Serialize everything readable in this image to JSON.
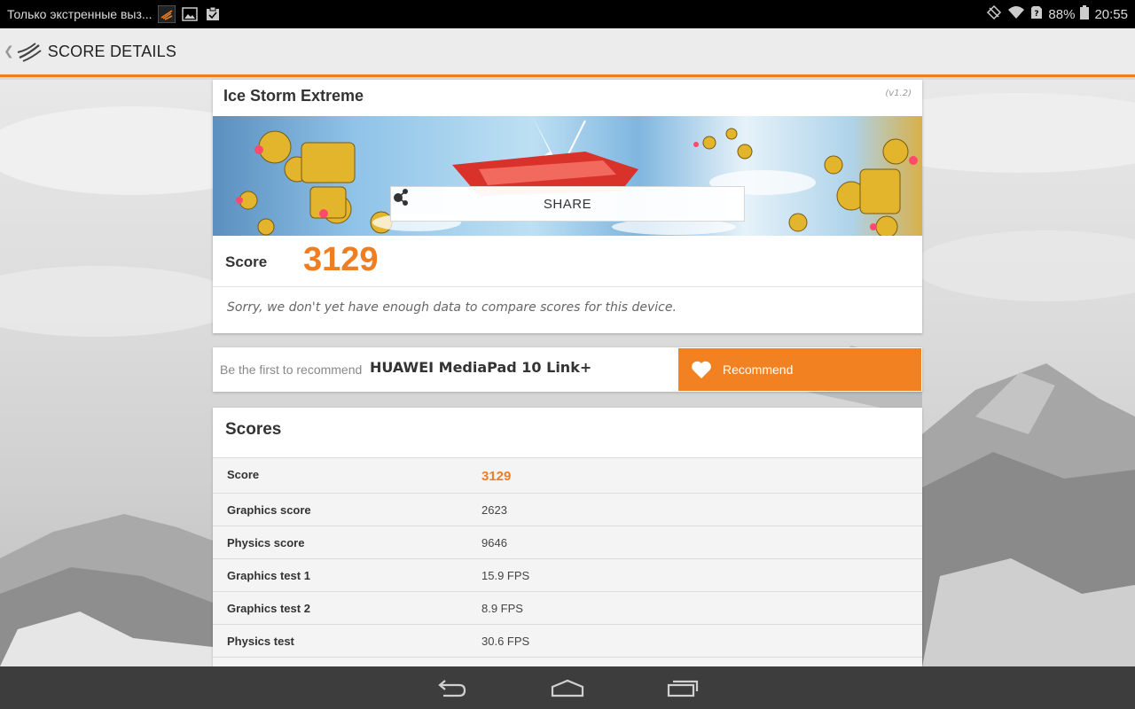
{
  "status_bar": {
    "notification_text": "Только экстренные выз...",
    "battery": "88%",
    "time": "20:55"
  },
  "action_bar": {
    "title": "SCORE DETAILS"
  },
  "test_card": {
    "title": "Ice Storm Extreme",
    "version": "(v1.2)",
    "share_label": "SHARE",
    "score_label": "Score",
    "score_value": "3129",
    "compare_note": "Sorry, we don't yet have enough data to compare scores for this device."
  },
  "recommend": {
    "prefix": "Be the first to recommend",
    "device": "HUAWEI MediaPad 10 Link+",
    "button_label": "Recommend"
  },
  "scores": {
    "title": "Scores",
    "rows": [
      {
        "label": "Score",
        "value": "3129"
      },
      {
        "label": "Graphics score",
        "value": "2623"
      },
      {
        "label": "Physics score",
        "value": "9646"
      },
      {
        "label": "Graphics test 1",
        "value": "15.9 FPS"
      },
      {
        "label": "Graphics test 2",
        "value": "8.9 FPS"
      },
      {
        "label": "Physics test",
        "value": "30.6 FPS"
      }
    ]
  },
  "colors": {
    "accent": "#ef7d22",
    "recommend_button": "#f28122",
    "navbar": "#3d3d3d"
  },
  "icons": {
    "app_logo": "3dmark-logo-icon",
    "share": "share-icon",
    "recommend": "heart-icon",
    "nav_back": "back-icon",
    "nav_home": "home-icon",
    "nav_recents": "recents-icon"
  }
}
